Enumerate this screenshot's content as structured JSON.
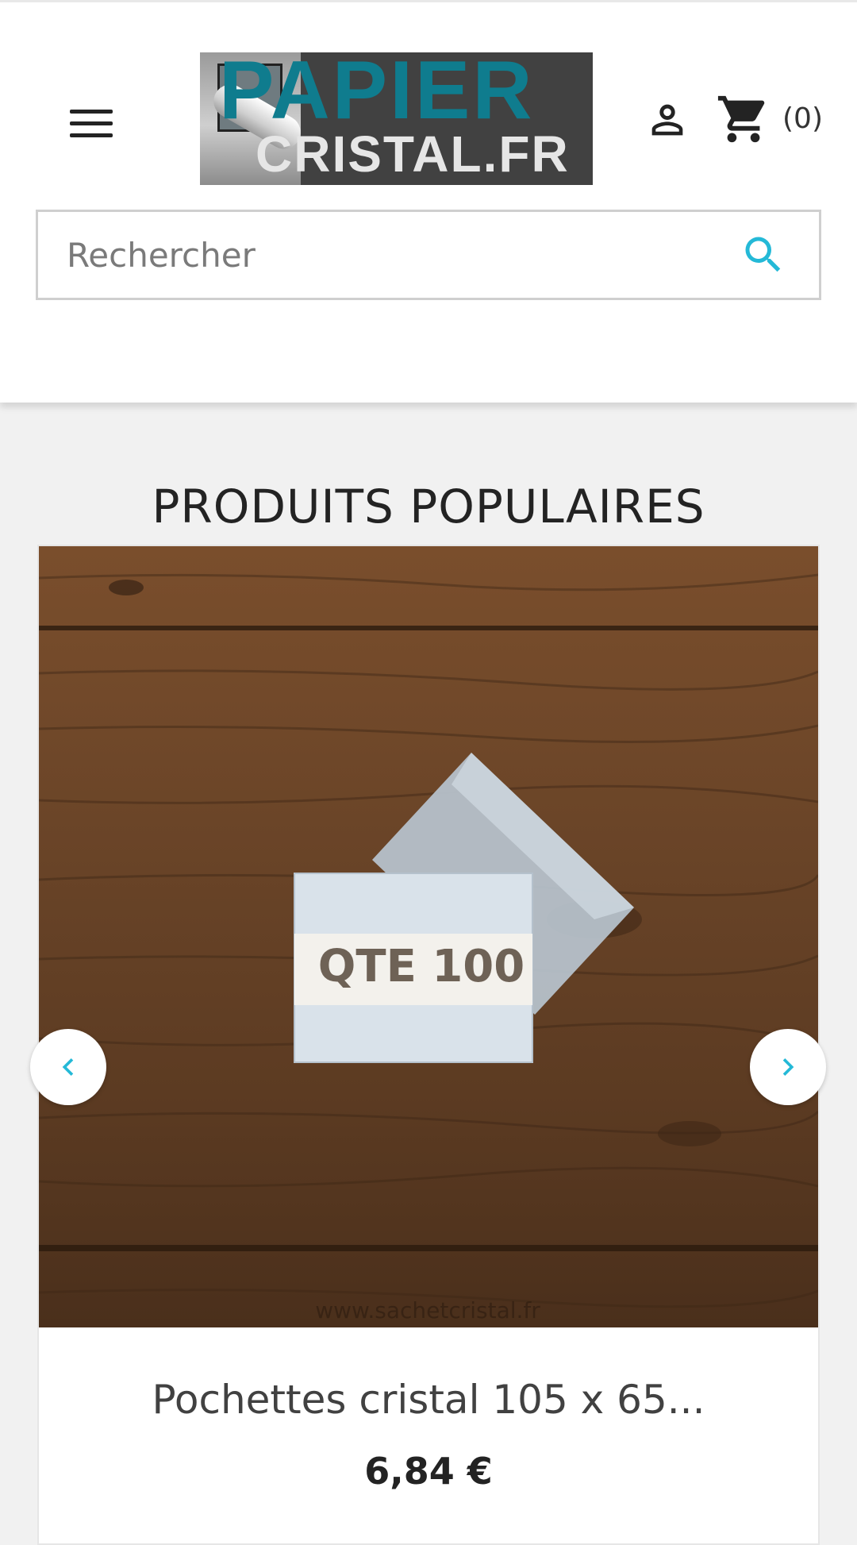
{
  "header": {
    "logo": {
      "line1": "PAPIER",
      "line2": "CRISTAL.FR"
    },
    "menu_icon": "hamburger-menu-icon",
    "account_icon": "user-icon",
    "cart_icon": "shopping-cart-icon",
    "cart_count": "(0)"
  },
  "search": {
    "placeholder": "Rechercher",
    "value": "",
    "icon": "search-icon"
  },
  "section": {
    "title": "PRODUITS POPULAIRES"
  },
  "product": {
    "image_label": "QTE 100",
    "watermark": "www.sachetcristal.fr",
    "name": "Pochettes cristal 105 x 65...",
    "price": "6,84 €"
  },
  "carousel": {
    "prev_icon": "chevron-left-icon",
    "next_icon": "chevron-right-icon"
  },
  "colors": {
    "accent": "#24b9d7",
    "logo_teal": "#0f7c8e",
    "text_dark": "#232323",
    "page_bg": "#f1f1f1"
  }
}
